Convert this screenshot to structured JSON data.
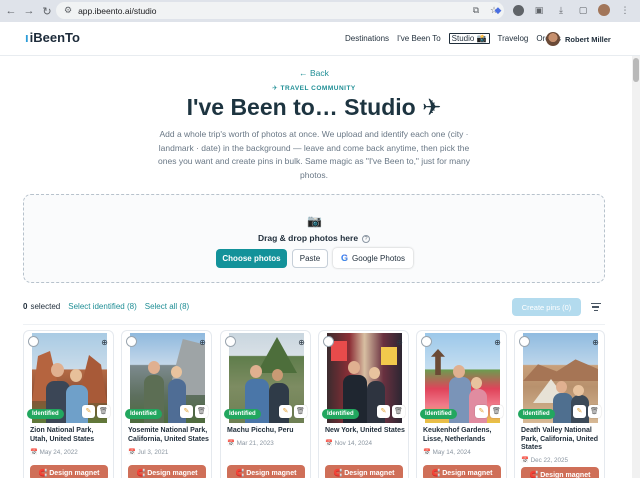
{
  "browser": {
    "url": "app.ibeento.ai/studio"
  },
  "site": {
    "logo_mark": "ı",
    "logo_text": "iBeenTo",
    "nav": [
      "Destinations",
      "I've Been To",
      "Studio 📸",
      "Travelog",
      "Orders"
    ],
    "user_name": "Robert Miller"
  },
  "hero": {
    "back": "← Back",
    "eyebrow": "✈ TRAVEL COMMUNITY",
    "title": "I've Been to… Studio ✈",
    "description": "Add a whole trip's worth of photos at once. We upload and identify each one (city · landmark · date) in the background — leave and come back anytime, then pick the ones you want and create pins in bulk. Same magic as \"I've Been to,\" just for many photos."
  },
  "dropzone": {
    "icon": "📷",
    "label": "Drag & drop photos here",
    "help": "?",
    "choose": "Choose photos",
    "paste": "Paste",
    "google_g": "G",
    "google": "Google Photos"
  },
  "selection": {
    "count": "0",
    "selected_text": "selected",
    "select_identified": "Select identified (8)",
    "select_all": "Select all (8)",
    "create_pins": "Create pins (0)"
  },
  "cards": [
    {
      "place": "Zion National Park, Utah, United States",
      "date": "📅 May 24, 2022",
      "badge": "Identified",
      "magnet": "🧲 Design magnet"
    },
    {
      "place": "Yosemite National Park, California, United States",
      "date": "📅 Jul 3, 2021",
      "badge": "Identified",
      "magnet": "🧲 Design magnet"
    },
    {
      "place": "Machu Picchu, Peru",
      "date": "📅 Mar 21, 2023",
      "badge": "Identified",
      "magnet": "🧲 Design magnet"
    },
    {
      "place": "New York, United States",
      "date": "📅 Nov 14, 2024",
      "badge": "Identified",
      "magnet": "🧲 Design magnet"
    },
    {
      "place": "Keukenhof Gardens, Lisse, Netherlands",
      "date": "📅 May 14, 2024",
      "badge": "Identified",
      "magnet": "🧲 Design magnet"
    },
    {
      "place": "Death Valley National Park, California, United States",
      "date": "📅 Dec 22, 2025",
      "badge": "Identified",
      "magnet": "🧲 Design magnet"
    }
  ],
  "colors": {
    "accent": "#13929a",
    "magnet": "#cf6f58",
    "identified": "#22a75f",
    "create_disabled": "#b3dbee"
  }
}
